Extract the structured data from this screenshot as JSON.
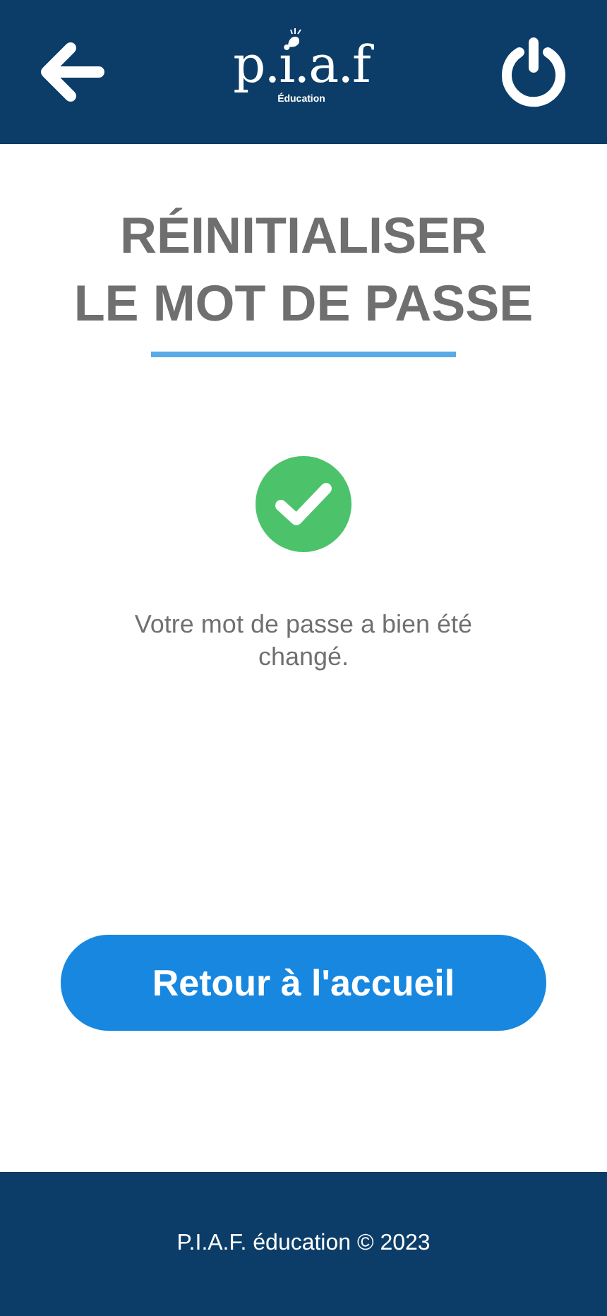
{
  "header": {
    "logo": {
      "name": "p.i.a.f",
      "tagline": "Éducation"
    }
  },
  "title": {
    "lines": [
      "RÉINITIALISER",
      "LE MOT DE PASSE"
    ]
  },
  "message": "Votre mot de passe a bien été changé.",
  "button": "Retour à l'accueil",
  "footer": "P.I.A.F. éducation © 2023"
}
